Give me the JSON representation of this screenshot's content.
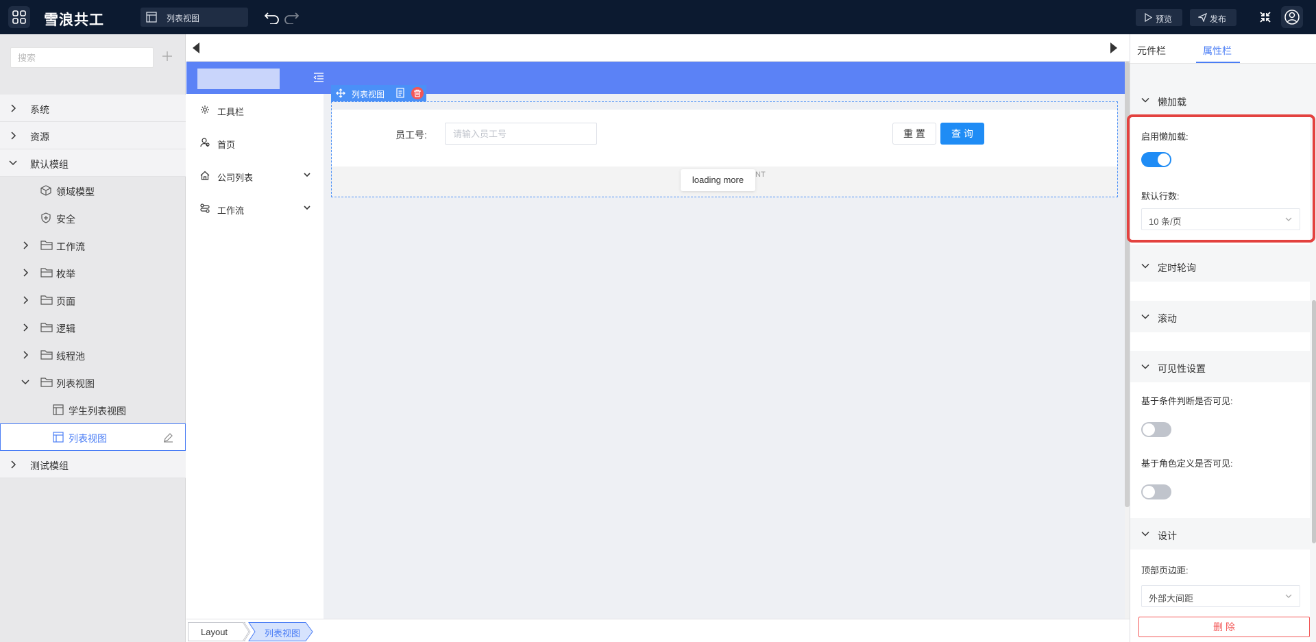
{
  "app": {
    "title": "雪浪共工",
    "doc_tab": "列表视图"
  },
  "toolbar": {
    "preview_label": "预览",
    "publish_label": "发布"
  },
  "sidebar": {
    "search_placeholder": "搜索",
    "items": [
      {
        "label": "系统"
      },
      {
        "label": "资源"
      },
      {
        "label": "默认模组"
      },
      {
        "label": "领域模型"
      },
      {
        "label": "安全"
      },
      {
        "label": "工作流"
      },
      {
        "label": "枚举"
      },
      {
        "label": "页面"
      },
      {
        "label": "逻辑"
      },
      {
        "label": "线程池"
      },
      {
        "label": "列表视图"
      },
      {
        "label": "学生列表视图"
      },
      {
        "label": "列表视图"
      },
      {
        "label": "测试模组"
      }
    ]
  },
  "preview": {
    "nav": [
      {
        "label": "工具栏"
      },
      {
        "label": "首页"
      },
      {
        "label": "公司列表"
      },
      {
        "label": "工作流"
      }
    ],
    "widget_name": "列表视图",
    "filter": {
      "label": "员工号:",
      "placeholder": "请输入员工号",
      "reset": "重 置",
      "query": "查 询"
    },
    "loading_text": "loading more",
    "ghost_text": "NT"
  },
  "breadcrumb": {
    "root": "Layout",
    "current": "列表视图"
  },
  "right_panel": {
    "tabs": {
      "components": "元件栏",
      "properties": "属性栏"
    },
    "lazy_load": {
      "title": "懒加载",
      "enable_label": "启用懒加载:",
      "enabled": true,
      "rows_label": "默认行数:",
      "rows_value": "10 条/页"
    },
    "polling_title": "定时轮询",
    "scroll_title": "滚动",
    "visibility": {
      "title": "可见性设置",
      "condition_label": "基于条件判断是否可见:",
      "condition_enabled": false,
      "role_label": "基于角色定义是否可见:",
      "role_enabled": false
    },
    "design": {
      "title": "设计",
      "top_margin_label": "顶部页边距:",
      "top_margin_value": "外部大间距"
    },
    "delete_label": "删 除"
  },
  "colors": {
    "accent": "#4a7df5",
    "primary_button": "#1f8cf5",
    "danger": "#f35656",
    "topbar": "#0c1a30",
    "highlight": "#e3423f"
  }
}
